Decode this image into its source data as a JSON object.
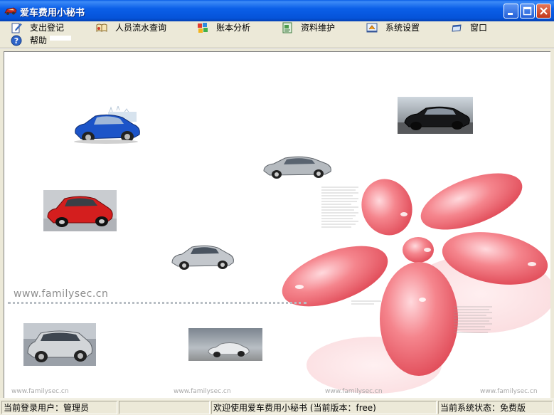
{
  "window": {
    "title": "爱车费用小秘书"
  },
  "menu": {
    "items": [
      {
        "label": "支出登记",
        "icon": "notepad-pencil-icon"
      },
      {
        "label": "人员流水查询",
        "icon": "book-icon"
      },
      {
        "label": "账本分析",
        "icon": "colored-blocks-icon"
      },
      {
        "label": "资料维护",
        "icon": "document-icon"
      },
      {
        "label": "系统设置",
        "icon": "settings-icon"
      },
      {
        "label": "窗口",
        "icon": "window-icon"
      },
      {
        "label": "帮助",
        "icon": "help-icon"
      }
    ]
  },
  "background": {
    "watermark": "www.familysec.cn",
    "footer_watermarks": [
      "www.familysec.cn",
      "www.familysec.cn",
      "www.familysec.cn",
      "www.familysec.cn"
    ]
  },
  "status": {
    "user": "当前登录用户：管理员",
    "welcome": "欢迎使用爱车费用小秘书  (当前版本：free)",
    "state": "当前系统状态：免费版"
  },
  "colors": {
    "titlebar": "#0553d9",
    "chrome": "#ece9d8",
    "petal": "#f0707a"
  }
}
